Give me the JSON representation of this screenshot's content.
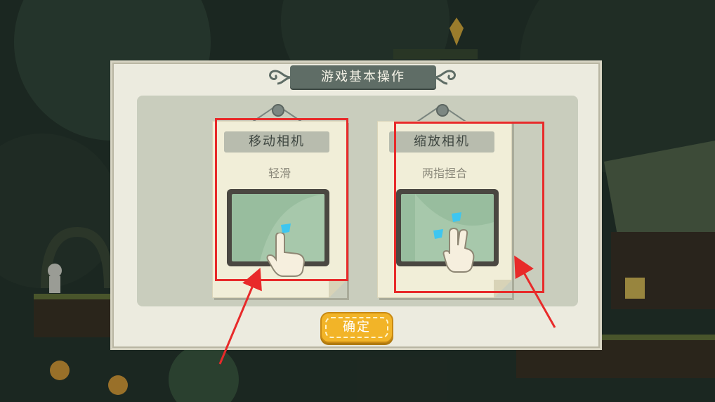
{
  "dialog": {
    "title": "游戏基本操作",
    "confirm_label": "确定"
  },
  "cards": [
    {
      "title": "移动相机",
      "subtitle": "轻滑"
    },
    {
      "title": "缩放相机",
      "subtitle": "两指捏合"
    }
  ],
  "colors": {
    "banner": "#5f6d66",
    "button": "#f2b428",
    "highlight": "#e82a2a",
    "touch_marker": "#3ec6f0"
  },
  "icons": [
    "hand-swipe-icon",
    "hand-pinch-icon",
    "touch-point-icon",
    "pin-icon",
    "scroll-ornament-icon"
  ]
}
